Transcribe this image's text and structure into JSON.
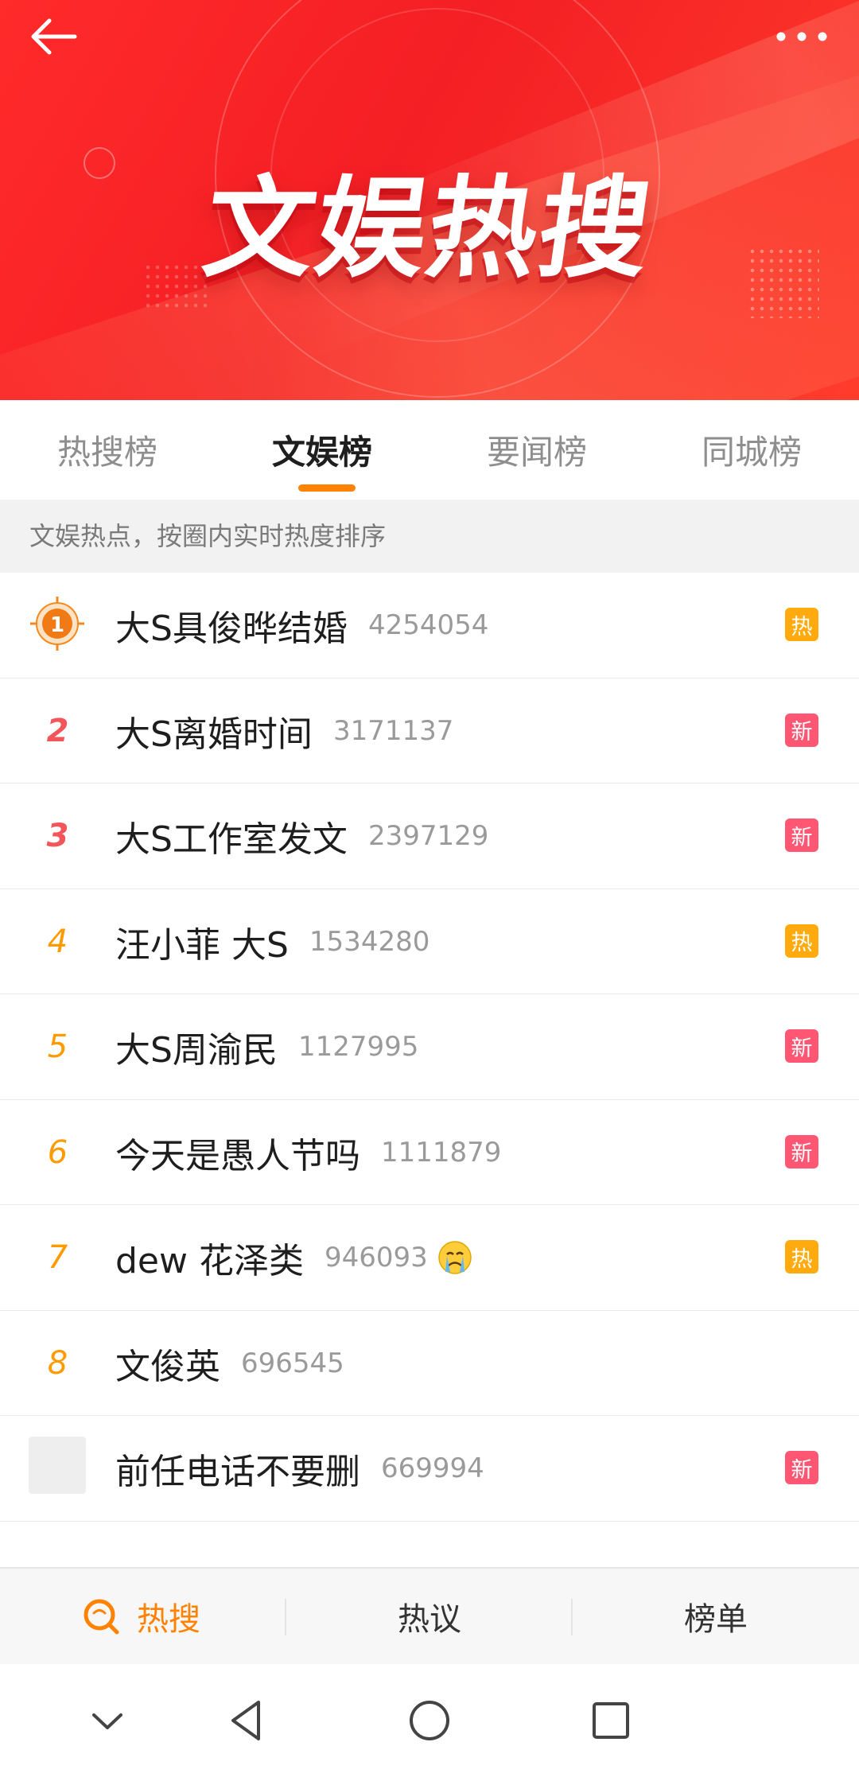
{
  "banner": {
    "title": "文娱热搜"
  },
  "tabs": [
    {
      "label": "热搜榜",
      "active": false
    },
    {
      "label": "文娱榜",
      "active": true
    },
    {
      "label": "要闻榜",
      "active": false
    },
    {
      "label": "同城榜",
      "active": false
    }
  ],
  "subtitle": "文娱热点，按圈内实时热度排序",
  "list": [
    {
      "rank": "1",
      "title": "大S具俊晔结婚",
      "count": "4254054",
      "badge": "热",
      "badge_type": "hot"
    },
    {
      "rank": "2",
      "title": "大S离婚时间",
      "count": "3171137",
      "badge": "新",
      "badge_type": "new"
    },
    {
      "rank": "3",
      "title": "大S工作室发文",
      "count": "2397129",
      "badge": "新",
      "badge_type": "new"
    },
    {
      "rank": "4",
      "title": "汪小菲 大S",
      "count": "1534280",
      "badge": "热",
      "badge_type": "hot"
    },
    {
      "rank": "5",
      "title": "大S周渝民",
      "count": "1127995",
      "badge": "新",
      "badge_type": "new"
    },
    {
      "rank": "6",
      "title": "今天是愚人节吗",
      "count": "1111879",
      "badge": "新",
      "badge_type": "new"
    },
    {
      "rank": "7",
      "title": "dew 花泽类",
      "count": "946093",
      "badge": "热",
      "badge_type": "hot",
      "emoji": "crying-face-icon"
    },
    {
      "rank": "8",
      "title": "文俊英",
      "count": "696545",
      "badge": "",
      "badge_type": "none"
    },
    {
      "rank": "",
      "title": "前任电话不要删",
      "count": "669994",
      "badge": "新",
      "badge_type": "new"
    }
  ],
  "bottom_nav": [
    {
      "label": "热搜",
      "active": true,
      "icon": "hot-search-icon"
    },
    {
      "label": "热议",
      "active": false
    },
    {
      "label": "榜单",
      "active": false
    }
  ],
  "colors": {
    "accent": "#ff8200",
    "hot_badge": "#ffab0f",
    "new_badge": "#ff5773",
    "rank_top": "#f2555a",
    "rank_other": "#ff9a00"
  }
}
